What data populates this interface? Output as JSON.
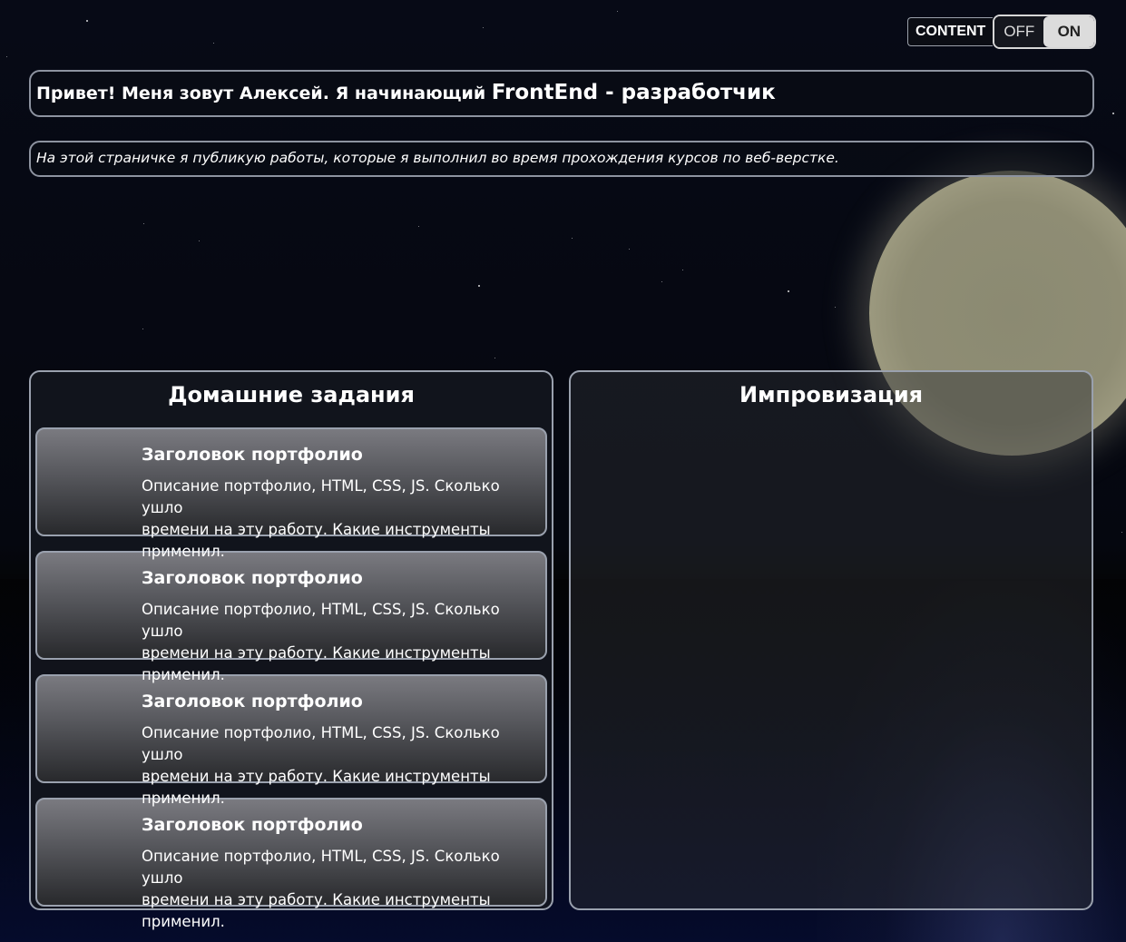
{
  "toggle": {
    "label": "CONTENT",
    "off_label": "OFF",
    "on_label": "ON",
    "state": "ON"
  },
  "intro": {
    "text": "Привет! Меня зовут Алексей. Я начинающий ",
    "highlight": "FrontEnd - разработчик"
  },
  "about": {
    "text": "На этой страничке я публикую работы, которые я выполнил во время прохождения курсов по веб-верстке."
  },
  "homework": {
    "title": "Домашние задания",
    "cards": [
      {
        "title": "Заголовок портфолио",
        "description_line1": "Описание портфолио, HTML, CSS, JS. Сколько ушло",
        "description_line2": "времени на эту работу. Какие инструменты применил."
      },
      {
        "title": "Заголовок портфолио",
        "description_line1": "Описание портфолио, HTML, CSS, JS. Сколько ушло",
        "description_line2": "времени на эту работу. Какие инструменты применил."
      },
      {
        "title": "Заголовок портфолио",
        "description_line1": "Описание портфолио, HTML, CSS, JS. Сколько ушло",
        "description_line2": "времени на эту работу. Какие инструменты применил."
      },
      {
        "title": "Заголовок портфолио",
        "description_line1": "Описание портфолио, HTML, CSS, JS. Сколько ушло",
        "description_line2": "времени на эту работу. Какие инструменты применил."
      }
    ]
  },
  "improvisation": {
    "title": "Импровизация"
  },
  "colors": {
    "sky": "#070a16",
    "moon": "#8f8d74",
    "panel_border": "#9aa1ae",
    "card_top": "#7a7a80",
    "card_bottom": "#28292c"
  }
}
